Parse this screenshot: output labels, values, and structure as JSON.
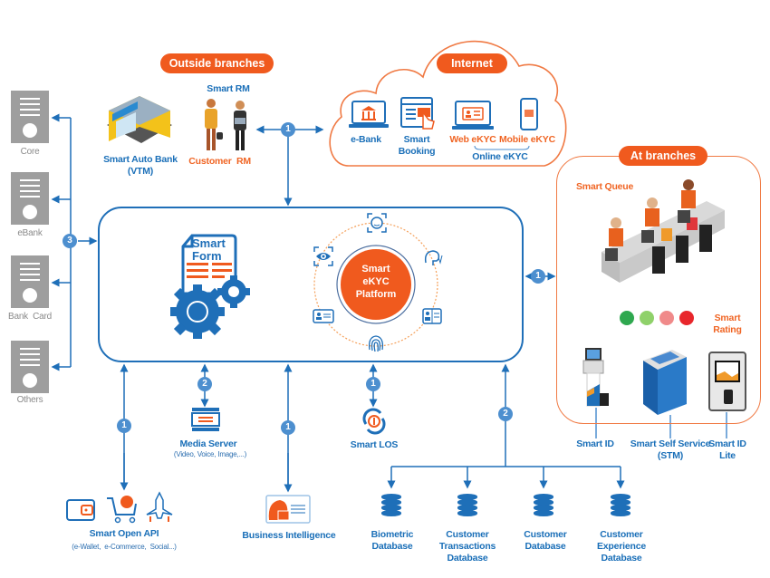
{
  "sections": {
    "outside_branches": "Outside branches",
    "internet": "Internet",
    "at_branches": "At branches"
  },
  "core_systems": [
    {
      "label": "Core"
    },
    {
      "label": "eBank"
    },
    {
      "label": "Bank  Card"
    },
    {
      "label": "Others"
    }
  ],
  "outside": {
    "vtm_label_1": "Smart Auto Bank",
    "vtm_label_2": "(VTM)",
    "smart_rm": "Smart RM",
    "customer": "Customer",
    "rm": "RM"
  },
  "internet": {
    "items": [
      {
        "label": "e-Bank",
        "color": "blue"
      },
      {
        "label": "Smart Booking",
        "color": "blue"
      },
      {
        "label": "Web eKYC",
        "color": "orange"
      },
      {
        "label": "Mobile eKYC",
        "color": "orange"
      }
    ],
    "group_label": "Online eKYC"
  },
  "platform": {
    "smart_form_1": "Smart",
    "smart_form_2": "Form",
    "ekyc_1": "Smart",
    "ekyc_2": "eKYC",
    "ekyc_3": "Platform"
  },
  "branches": {
    "smart_queue": "Smart Queue",
    "smart_rating": "Smart Rating",
    "rating_colors": [
      "#2fa84f",
      "#8fd16a",
      "#f08a8a",
      "#e8262b"
    ],
    "devices": [
      {
        "label_1": "Smart ID",
        "label_2": ""
      },
      {
        "label_1": "Smart Self Service",
        "label_2": "(STM)"
      },
      {
        "label_1": "Smart ID",
        "label_2": "Lite"
      }
    ]
  },
  "bottom": {
    "media_server": "Media Server",
    "media_server_sub": "(Video, Voice, Image,...)",
    "smart_los": "Smart LOS",
    "open_api": "Smart Open API",
    "open_api_sub": "(e-Wallet,  e-Commerce,  Social...)",
    "bi": "Business Intelligence"
  },
  "databases": [
    {
      "label_1": "Biometric",
      "label_2": "Database"
    },
    {
      "label_1": "Customer Transactions",
      "label_2": "Database"
    },
    {
      "label_1": "Customer",
      "label_2": "Database"
    },
    {
      "label_1": "Customer Experience",
      "label_2": "Database"
    }
  ],
  "badges": {
    "one": "1",
    "two": "2",
    "three": "3"
  },
  "colors": {
    "brand_blue": "#1f6fb8",
    "brand_orange": "#f05a1e",
    "badge_blue": "#4d8fcf",
    "server_grey": "#9e9e9e"
  }
}
